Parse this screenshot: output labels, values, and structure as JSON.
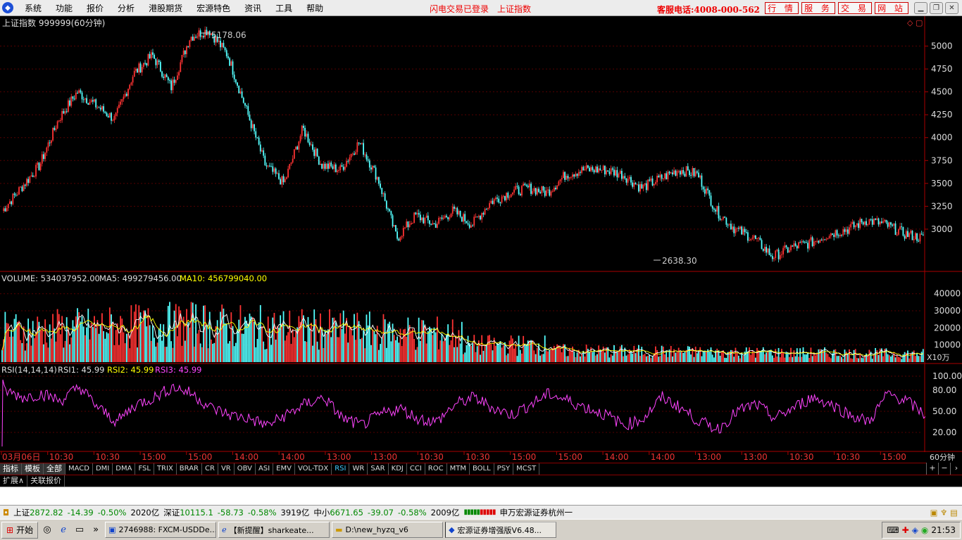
{
  "menubar": {
    "items": [
      "系统",
      "功能",
      "报价",
      "分析",
      "港股期货",
      "宏源特色",
      "资讯",
      "工具",
      "帮助"
    ],
    "login_status": "闪电交易已登录",
    "index_name": "上证指数",
    "phone": "客服电话:4008-000-562",
    "nav_buttons": [
      "行 情",
      "服 务",
      "交 易",
      "网 站"
    ]
  },
  "chart": {
    "title": "上证指数 999999(60分钟)",
    "high_label": "5178.06",
    "low_label": "2638.30",
    "price_ticks": [
      "5000",
      "4750",
      "4500",
      "4250",
      "4000",
      "3750",
      "3500",
      "3250",
      "3000"
    ],
    "volume_header": {
      "volume": "VOLUME: 534037952.00",
      "ma5": "MA5: 499279456.00",
      "ma10": "MA10: 456799040.00"
    },
    "volume_ticks": [
      "40000",
      "30000",
      "20000",
      "10000"
    ],
    "volume_unit": "X10万",
    "rsi_header": {
      "name": "RSI(14,14,14)",
      "rsi1": "RSI1: 45.99",
      "rsi2": "RSI2: 45.99",
      "rsi3": "RSI3: 45.99"
    },
    "rsi_ticks": [
      "100.00",
      "80.00",
      "50.00",
      "20.00"
    ],
    "time_labels": [
      "03月06日",
      "10:30",
      "10:30",
      "15:00",
      "15:00",
      "14:00",
      "14:00",
      "13:00",
      "13:00",
      "10:30",
      "10:30",
      "15:00",
      "15:00",
      "14:00",
      "14:00",
      "13:00",
      "13:00",
      "10:30",
      "10:30",
      "15:00"
    ],
    "period": "60分钟",
    "colors": {
      "up": "#ff3333",
      "down": "#54ffff",
      "ma5": "#ffffff",
      "ma10": "#ffff00",
      "rsi": "#ff44ff",
      "axis": "#aa0000",
      "grid": "#550000"
    }
  },
  "chart_data": {
    "type": "candlestick",
    "title": "上证指数 999999(60分钟)",
    "price_range": [
      2638.3,
      5178.06
    ],
    "high": 5178.06,
    "low": 2638.3,
    "close_path": [
      3200,
      3450,
      3700,
      4200,
      4500,
      4350,
      4200,
      4700,
      4900,
      4550,
      5100,
      5178,
      4900,
      4300,
      3700,
      3500,
      4100,
      3700,
      3650,
      3950,
      3550,
      2900,
      3150,
      3050,
      3200,
      3050,
      3300,
      3400,
      3450,
      3400,
      3600,
      3650,
      3650,
      3600,
      3450,
      3550,
      3650,
      3600,
      3200,
      3000,
      2900,
      2700,
      2800,
      2850,
      2950,
      3000,
      3100,
      3050,
      2950,
      2900
    ],
    "rsi_path": [
      80,
      70,
      75,
      65,
      85,
      55,
      35,
      60,
      70,
      85,
      75,
      55,
      45,
      40,
      30,
      45,
      60,
      70,
      40,
      30,
      45,
      55,
      40,
      35,
      60,
      70,
      55,
      45,
      60,
      75,
      65,
      55,
      45,
      30,
      40,
      70,
      55,
      35,
      25,
      50,
      60,
      40,
      55,
      70,
      60,
      45,
      35,
      75,
      65,
      45
    ]
  },
  "tabs": {
    "indicator_group": [
      "指标",
      "模板",
      "全部"
    ],
    "indicators": [
      "MACD",
      "DMI",
      "DMA",
      "FSL",
      "TRIX",
      "BRAR",
      "CR",
      "VR",
      "OBV",
      "ASI",
      "EMV",
      "VOL-TDX",
      "RSI",
      "WR",
      "SAR",
      "KDJ",
      "CCI",
      "ROC",
      "MTM",
      "BOLL",
      "PSY",
      "MCST"
    ],
    "active": "RSI",
    "tools": [
      "+",
      "−",
      "›"
    ],
    "sub": [
      "扩展∧",
      "关联报价"
    ]
  },
  "statusbar": {
    "sh_name": "上证",
    "sh_value": "2872.82",
    "sh_change": "-14.39",
    "sh_pct": "-0.50%",
    "sh_amount": "2020亿",
    "sz_name": "深证",
    "sz_value": "10115.1",
    "sz_change": "-58.73",
    "sz_pct": "-0.58%",
    "sz_amount": "3919亿",
    "zx_name": "中小",
    "zx_value": "6671.65",
    "zx_change": "-39.07",
    "zx_pct": "-0.58%",
    "zx_amount": "2009亿",
    "broker": "申万宏源证券杭州一"
  },
  "taskbar": {
    "start": "开始",
    "tasks": [
      "2746988: FXCM-USDDe...",
      "【新提醒】sharkeate...",
      "D:\\new_hyzq_v6",
      "宏源证券增强版V6.48..."
    ],
    "clock": "21:53"
  }
}
